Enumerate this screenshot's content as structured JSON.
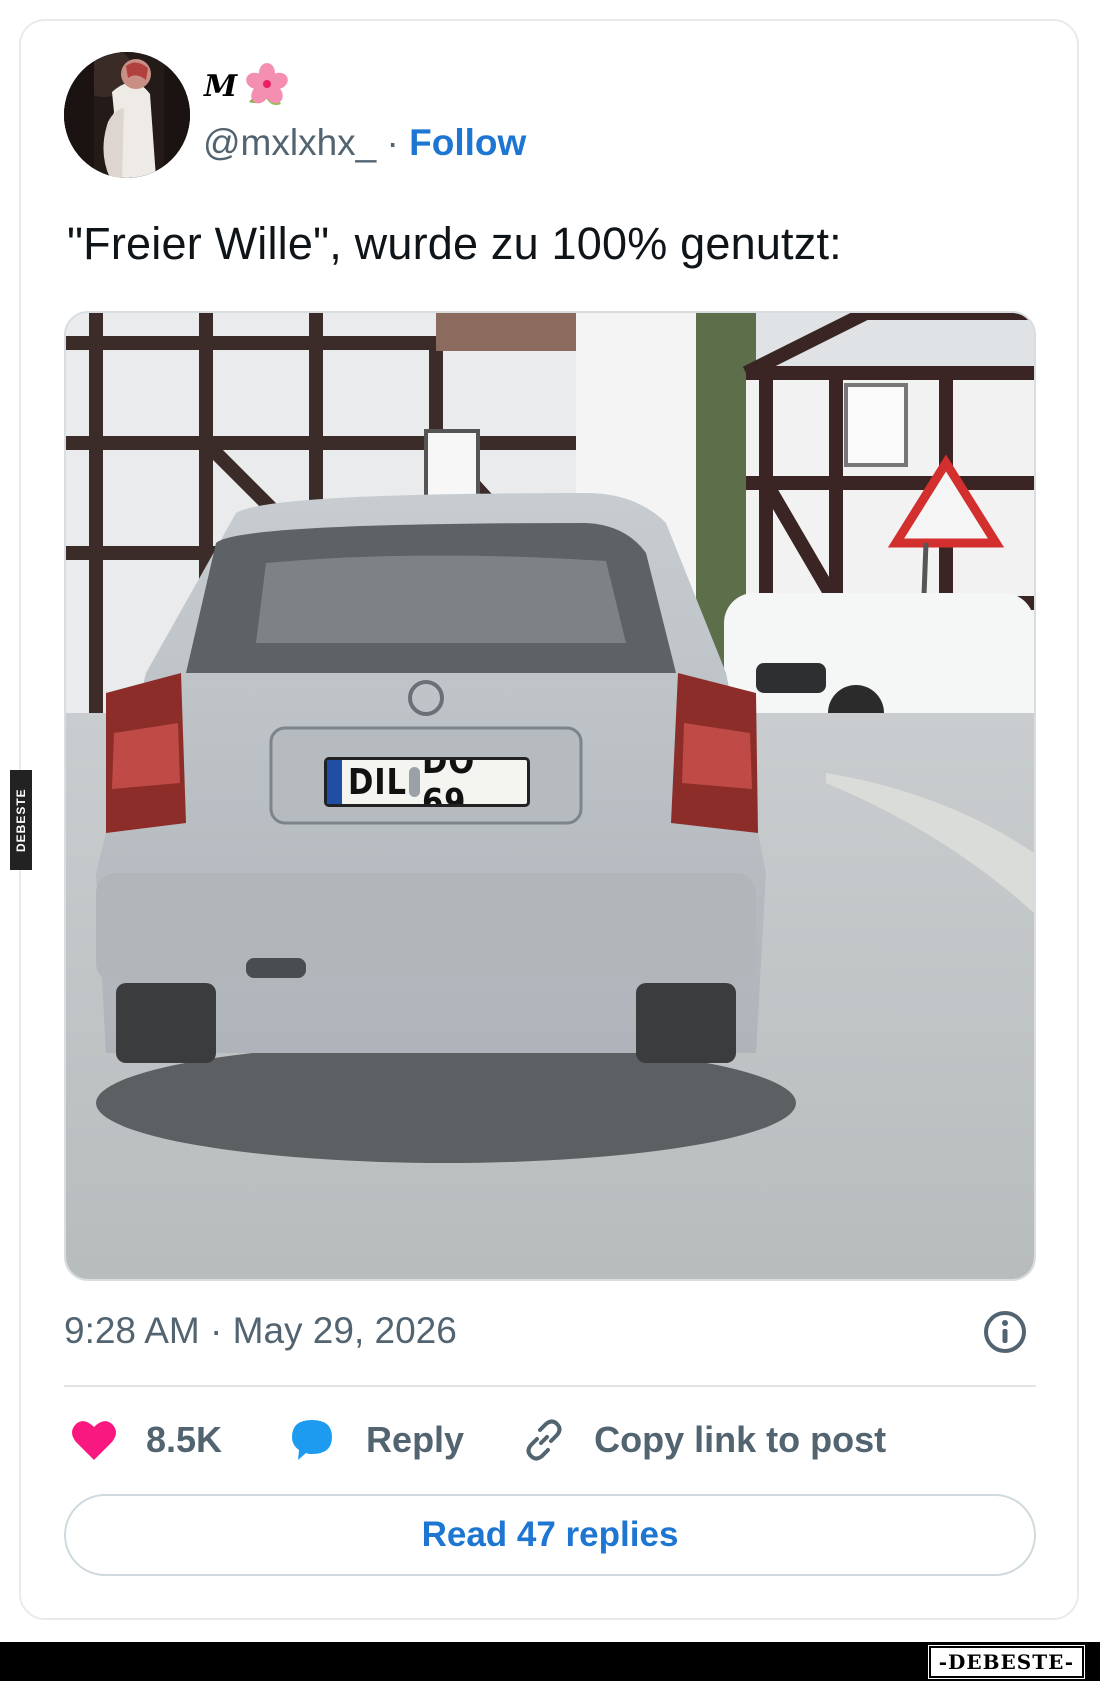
{
  "author": {
    "display_name": "M",
    "name_emoji": "pink-flower-icon",
    "handle": "@mxlxhx_",
    "separator": "·",
    "follow_label": "Follow"
  },
  "tweet": {
    "text": "\"Freier Wille\", wurde zu 100% genutzt:",
    "image": {
      "plate_region": "DIL",
      "plate_number": "DO 69"
    },
    "timestamp": "9:28 AM · May 29, 2026"
  },
  "actions": {
    "likes_count": "8.5K",
    "reply_label": "Reply",
    "copy_link_label": "Copy link to post"
  },
  "read_replies_label": "Read 47 replies",
  "watermark": {
    "side": "DEBESTE",
    "bottom": "-DEBESTE-"
  },
  "colors": {
    "follow_blue": "#1d76d2",
    "heart": "#f91880",
    "reply_bubble": "#1d9bf0",
    "muted_text": "#536471"
  }
}
